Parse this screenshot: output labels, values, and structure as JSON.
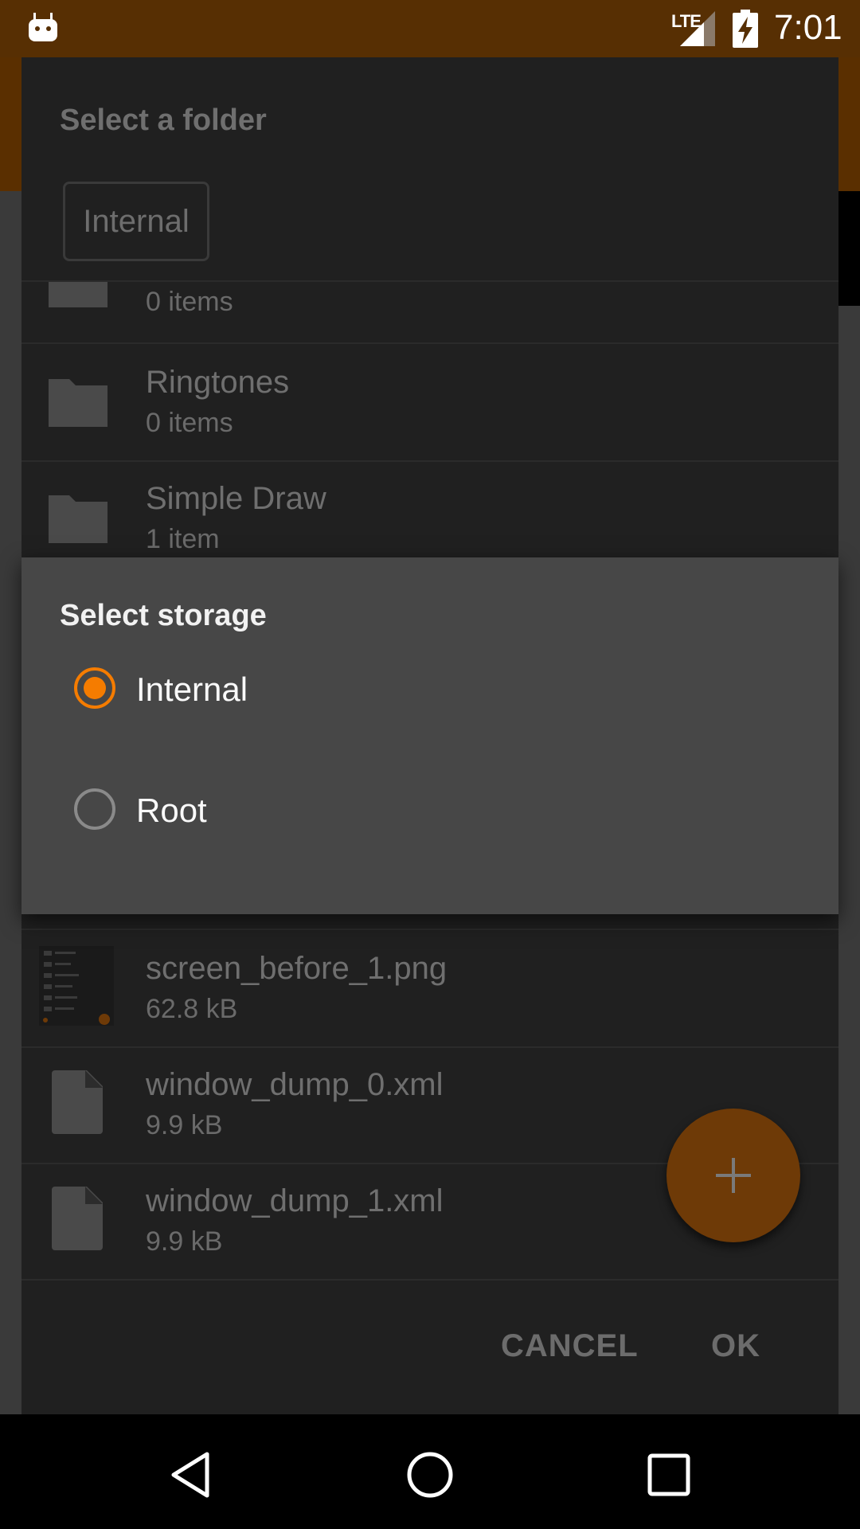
{
  "status_bar": {
    "network_label": "LTE",
    "time": "7:01",
    "icons": [
      "android-debug-icon",
      "signal-icon",
      "battery-charging-icon"
    ]
  },
  "folder_dialog": {
    "title": "Select a folder",
    "storage_chip": "Internal",
    "items": [
      {
        "name": "",
        "meta": "0 items",
        "icon": "folder-icon"
      },
      {
        "name": "Ringtones",
        "meta": "0 items",
        "icon": "folder-icon"
      },
      {
        "name": "Simple Draw",
        "meta": "1 item",
        "icon": "folder-icon"
      },
      {
        "name": "screen_before_1.png",
        "meta": "62.8 kB",
        "icon": "image-thumbnail"
      },
      {
        "name": "window_dump_0.xml",
        "meta": "9.9 kB",
        "icon": "file-icon"
      },
      {
        "name": "window_dump_1.xml",
        "meta": "9.9 kB",
        "icon": "file-icon"
      }
    ],
    "cancel_label": "CANCEL",
    "ok_label": "OK",
    "fab_icon": "plus-icon"
  },
  "storage_dialog": {
    "title": "Select storage",
    "options": [
      {
        "label": "Internal",
        "selected": true
      },
      {
        "label": "Root",
        "selected": false
      }
    ]
  },
  "colors": {
    "accent": "#F57C00",
    "status_bar": "#572F03",
    "dialog_bg": "#474747",
    "dimmed_dialog_bg": "#202020"
  },
  "nav_bar": {
    "icons": [
      "back-icon",
      "home-icon",
      "recents-icon"
    ]
  }
}
